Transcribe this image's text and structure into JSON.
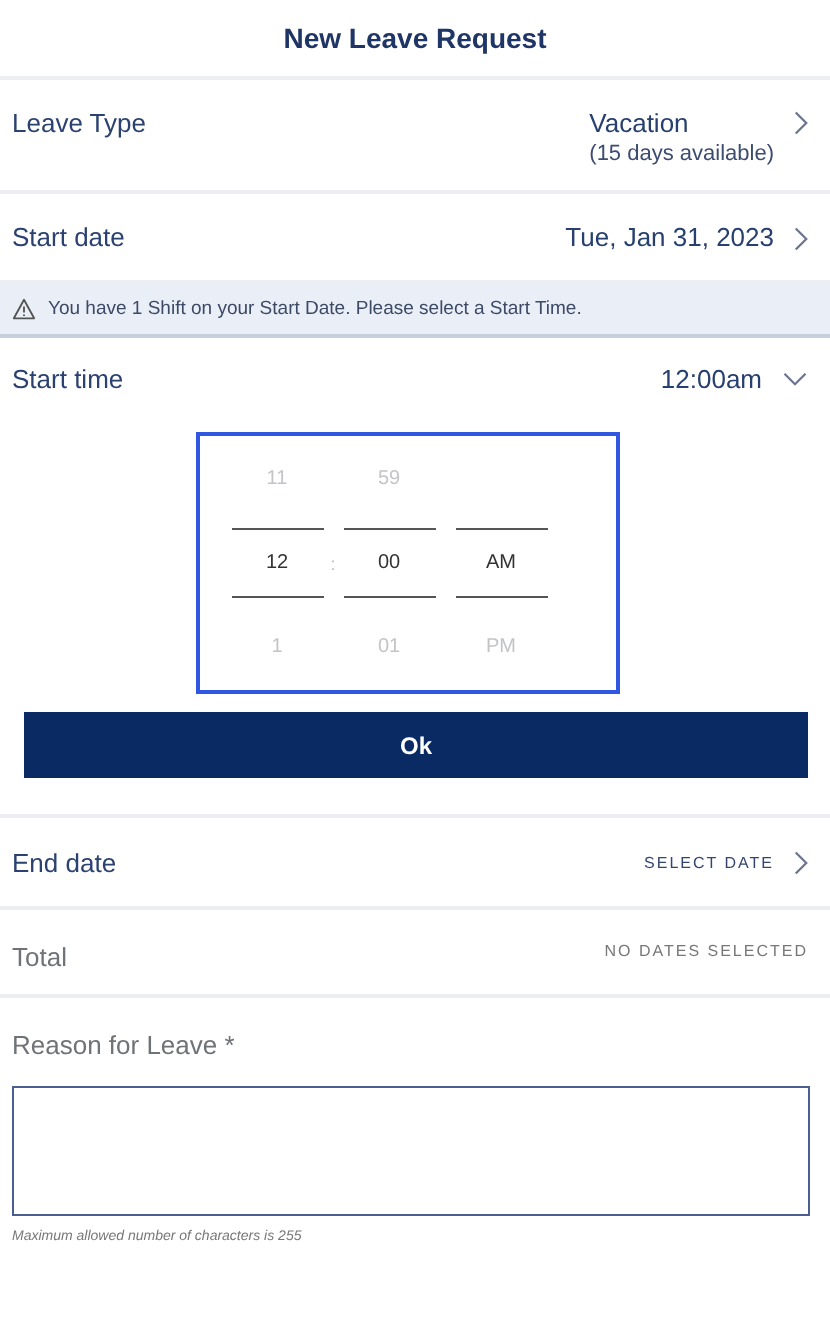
{
  "header": {
    "title": "New Leave Request"
  },
  "leave_type": {
    "label": "Leave Type",
    "value": "Vacation",
    "detail": "(15 days available)"
  },
  "start_date": {
    "label": "Start date",
    "value": "Tue, Jan 31, 2023"
  },
  "notice": {
    "text": "You have 1 Shift on your Start Date. Please select a Start Time."
  },
  "start_time": {
    "label": "Start time",
    "value": "12:00am",
    "expanded": true
  },
  "time_picker": {
    "separator": ":",
    "columns": [
      {
        "items": [
          {
            "label": "11",
            "selected": false
          },
          {
            "label": "12",
            "selected": true
          },
          {
            "label": "1",
            "selected": false
          }
        ]
      },
      {
        "items": [
          {
            "label": "59",
            "selected": false
          },
          {
            "label": "00",
            "selected": true
          },
          {
            "label": "01",
            "selected": false
          }
        ]
      },
      {
        "items": [
          {
            "label": "AM",
            "selected": true
          },
          {
            "label": "PM",
            "selected": false
          }
        ]
      }
    ]
  },
  "ok_button": {
    "label": "Ok"
  },
  "end_date": {
    "label": "End date",
    "value": "SELECT DATE"
  },
  "total": {
    "label": "Total",
    "value": "NO DATES SELECTED"
  },
  "reason": {
    "label": "Reason for Leave *",
    "hint": "Maximum allowed number of characters is 255"
  }
}
